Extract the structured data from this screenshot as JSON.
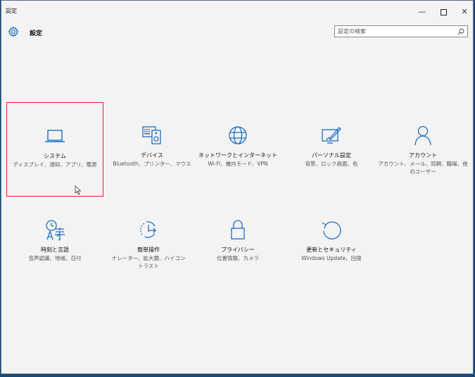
{
  "window": {
    "title": "設定",
    "minimize": "—",
    "close": "✕"
  },
  "header": {
    "heading": "設定",
    "search_placeholder": "設定の検索"
  },
  "tiles": [
    {
      "name": "システム",
      "desc": "ディスプレイ、通知、アプリ、電源",
      "icon": "laptop-icon"
    },
    {
      "name": "デバイス",
      "desc": "Bluetooth、プリンター、マウス",
      "icon": "devices-icon"
    },
    {
      "name": "ネットワークとインターネット",
      "desc": "Wi-Fi、機内モード、VPN",
      "icon": "globe-icon"
    },
    {
      "name": "パーソナル設定",
      "desc": "背景、ロック画面、色",
      "icon": "personalization-icon"
    },
    {
      "name": "アカウント",
      "desc": "アカウント、メール、同期、職場、他のユーザー",
      "icon": "person-icon"
    },
    {
      "name": "時刻と言語",
      "desc": "音声認識、地域、日付",
      "icon": "time-language-icon"
    },
    {
      "name": "簡単操作",
      "desc": "ナレーター、拡大鏡、ハイコントラスト",
      "icon": "ease-of-access-icon"
    },
    {
      "name": "プライバシー",
      "desc": "位置情報、カメラ",
      "icon": "lock-icon"
    },
    {
      "name": "更新とセキュリティ",
      "desc": "Windows Update、回復",
      "icon": "update-icon"
    }
  ]
}
